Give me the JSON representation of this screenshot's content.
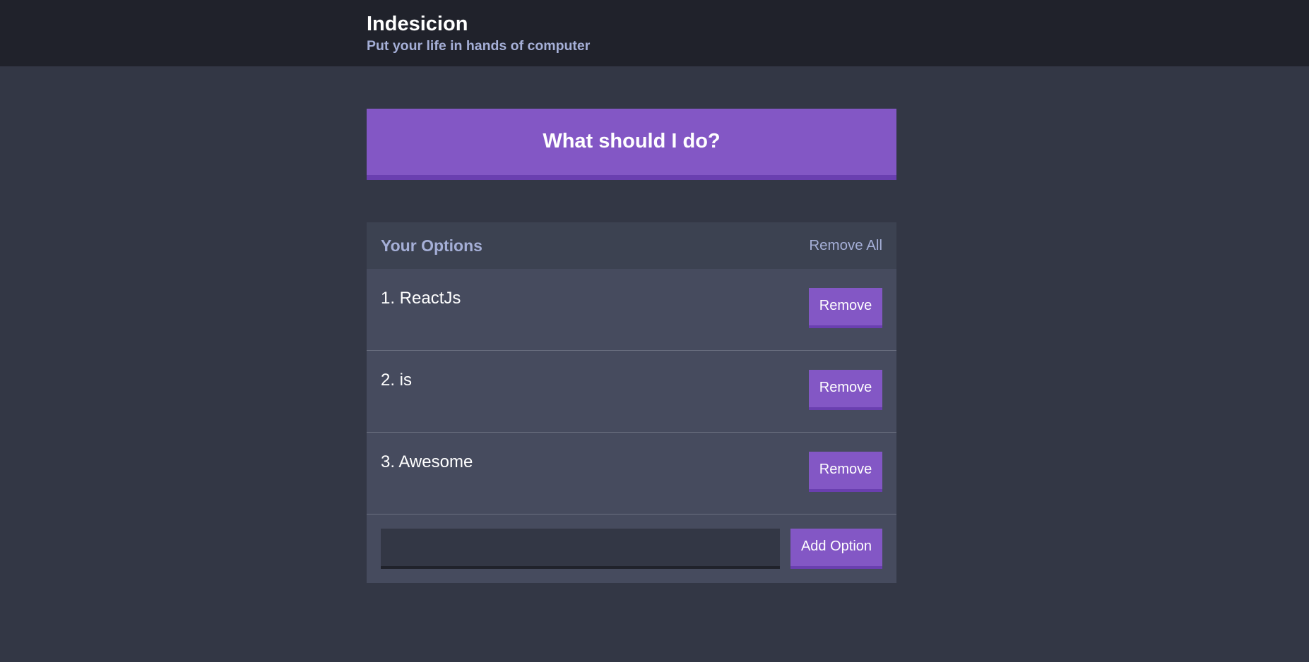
{
  "header": {
    "title": "Indesicion",
    "subtitle": "Put your life in hands of computer"
  },
  "action": {
    "label": "What should I do?"
  },
  "widget": {
    "title": "Your Options",
    "remove_all_label": "Remove All",
    "options": [
      {
        "text": "1. ReactJs",
        "remove_label": "Remove"
      },
      {
        "text": "2. is",
        "remove_label": "Remove"
      },
      {
        "text": "3. Awesome",
        "remove_label": "Remove"
      }
    ],
    "add_form": {
      "input_value": "",
      "button_label": "Add Option"
    }
  },
  "colors": {
    "background": "#333745",
    "header_background": "#20222b",
    "accent": "#8357c5",
    "accent_dark": "#6a3fb0",
    "muted_text": "#a5afd7",
    "widget_background": "#464b5e",
    "widget_header_background": "#3c4251"
  }
}
